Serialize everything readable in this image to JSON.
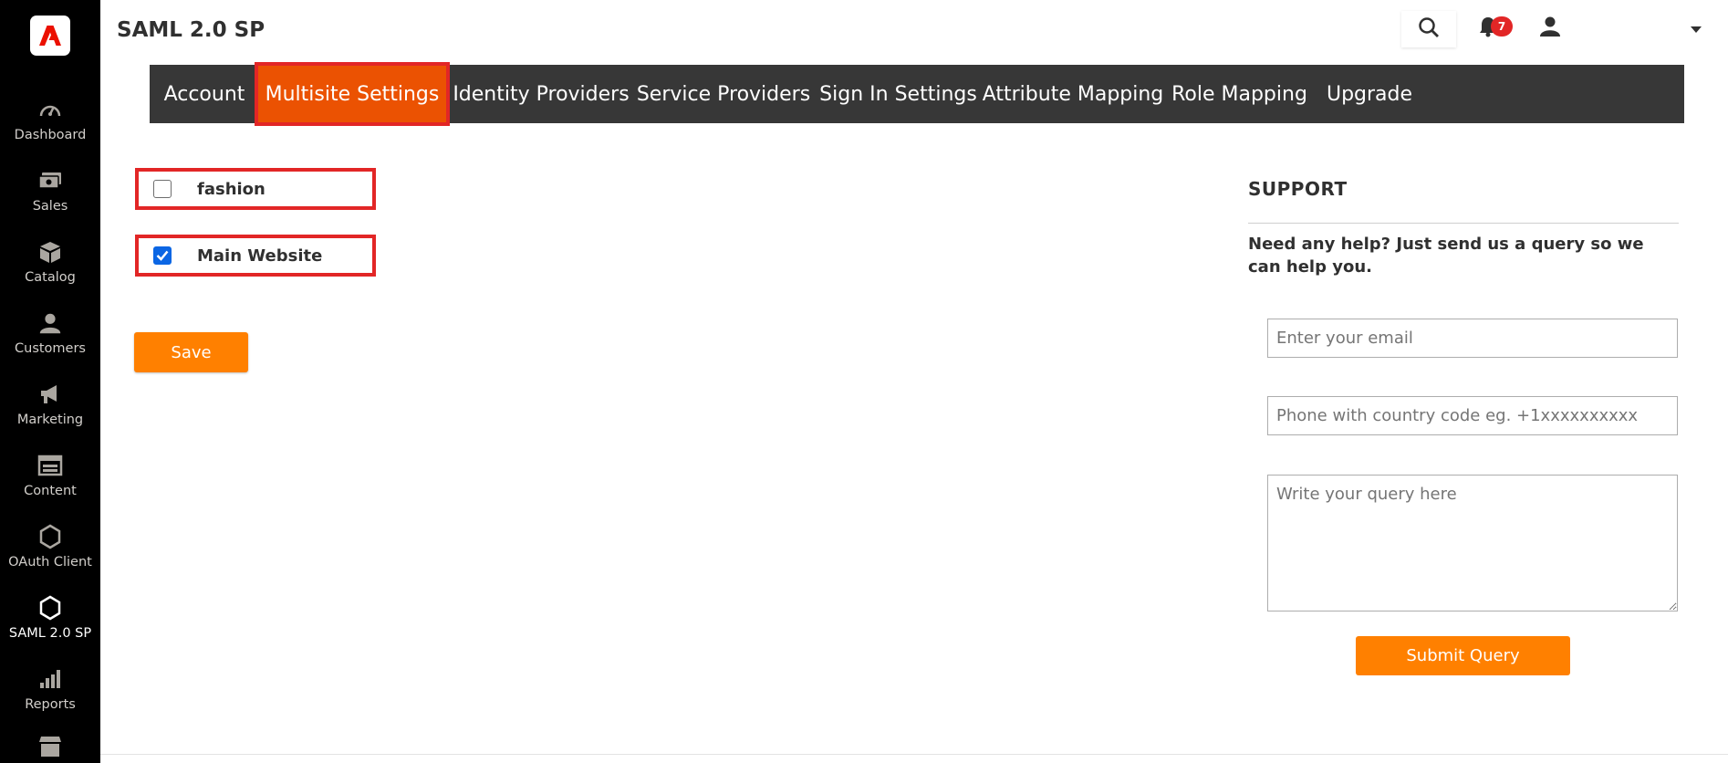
{
  "header": {
    "title": "SAML 2.0 SP",
    "notification_count": "7"
  },
  "sidebar": {
    "items": [
      {
        "label": "Dashboard",
        "icon": "dashboard-icon"
      },
      {
        "label": "Sales",
        "icon": "sales-icon"
      },
      {
        "label": "Catalog",
        "icon": "catalog-icon"
      },
      {
        "label": "Customers",
        "icon": "customers-icon"
      },
      {
        "label": "Marketing",
        "icon": "marketing-icon"
      },
      {
        "label": "Content",
        "icon": "content-icon"
      },
      {
        "label": "OAuth Client",
        "icon": "hexagon-icon"
      },
      {
        "label": "SAML 2.0 SP",
        "icon": "hexagon-icon",
        "active": true
      },
      {
        "label": "Reports",
        "icon": "reports-icon"
      }
    ]
  },
  "tabs": [
    {
      "label": "Account"
    },
    {
      "label": "Multisite Settings",
      "active": true
    },
    {
      "label": "Identity Providers"
    },
    {
      "label": "Service Providers"
    },
    {
      "label": "Sign In Settings"
    },
    {
      "label": "Attribute Mapping"
    },
    {
      "label": "Role Mapping"
    },
    {
      "label": "Upgrade"
    }
  ],
  "sites": [
    {
      "label": "fashion",
      "checked": false
    },
    {
      "label": "Main Website",
      "checked": true
    }
  ],
  "save_label": "Save",
  "support": {
    "title": "SUPPORT",
    "help_text": "Need any help? Just send us a query so we can help you.",
    "email_placeholder": "Enter your email",
    "phone_placeholder": "Phone with country code eg. +1xxxxxxxxxx",
    "query_placeholder": "Write your query here",
    "submit_label": "Submit Query"
  },
  "colors": {
    "accent": "#eb5202",
    "button": "#ff8000",
    "highlight": "#e22626",
    "tabbar": "#373737",
    "sidebar": "#000000"
  }
}
